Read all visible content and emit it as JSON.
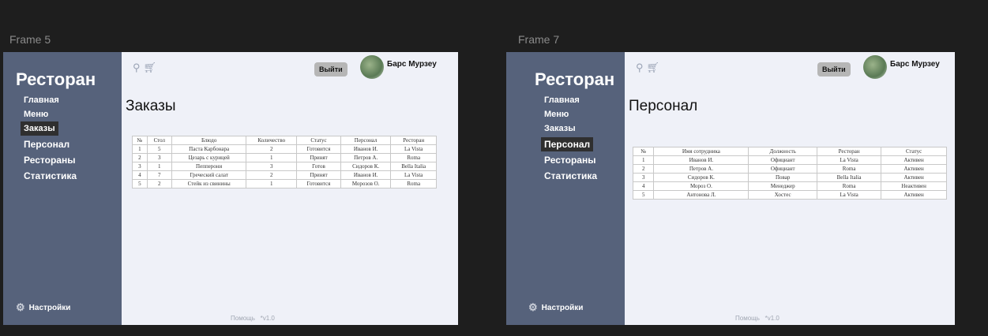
{
  "frames": [
    {
      "label": "Frame 5",
      "brand": "Ресторан",
      "nav": [
        "Главная",
        "Меню",
        "Заказы",
        "Персонал",
        "Рестораны",
        "Статистика"
      ],
      "settings": "Настройки",
      "logout": "Выйти",
      "user": "Барс Мурзеу",
      "title": "Заказы",
      "footer_help": "Помощь",
      "footer_version": "*v1.0",
      "table": {
        "headers": [
          "№",
          "Стол",
          "Блюдо",
          "Количество",
          "Статус",
          "Персонал",
          "Ресторан"
        ],
        "rows": [
          [
            "1",
            "5",
            "Паста Карбонара",
            "2",
            "Готовится",
            "Иванов И.",
            "La Vista"
          ],
          [
            "2",
            "3",
            "Цезарь с курицей",
            "1",
            "Принят",
            "Петров А.",
            "Roma"
          ],
          [
            "3",
            "1",
            "Пепперони",
            "3",
            "Готов",
            "Сидоров К.",
            "Bella Italia"
          ],
          [
            "4",
            "7",
            "Греческий салат",
            "2",
            "Принят",
            "Иванов И.",
            "La Vista"
          ],
          [
            "5",
            "2",
            "Стейк из свинины",
            "1",
            "Готовится",
            "Морозов О.",
            "Roma"
          ]
        ]
      }
    },
    {
      "label": "Frame 7",
      "brand": "Ресторан",
      "nav": [
        "Главная",
        "Меню",
        "Заказы",
        "Персонал",
        "Рестораны",
        "Статистика"
      ],
      "settings": "Настройки",
      "logout": "Выйти",
      "user": "Барс Мурзеу",
      "title": "Персонал",
      "footer_help": "Помощь",
      "footer_version": "*v1.0",
      "table": {
        "headers": [
          "№",
          "Имя сотрудника",
          "Должность",
          "Ресторан",
          "Статус"
        ],
        "rows": [
          [
            "1",
            "Иванов И.",
            "Официант",
            "La Vista",
            "Активен"
          ],
          [
            "2",
            "Петров А.",
            "Официант",
            "Roma",
            "Активен"
          ],
          [
            "3",
            "Сидоров К.",
            "Повар",
            "Bella Italia",
            "Активен"
          ],
          [
            "4",
            "Мороз О.",
            "Менеджер",
            "Roma",
            "Неактивен"
          ],
          [
            "5",
            "Антонова Л.",
            "Хостес",
            "La Vista",
            "Активен"
          ]
        ]
      }
    }
  ],
  "icons": {
    "search": "search-icon",
    "cart": "cart-icon",
    "settings": "gear-icon"
  }
}
